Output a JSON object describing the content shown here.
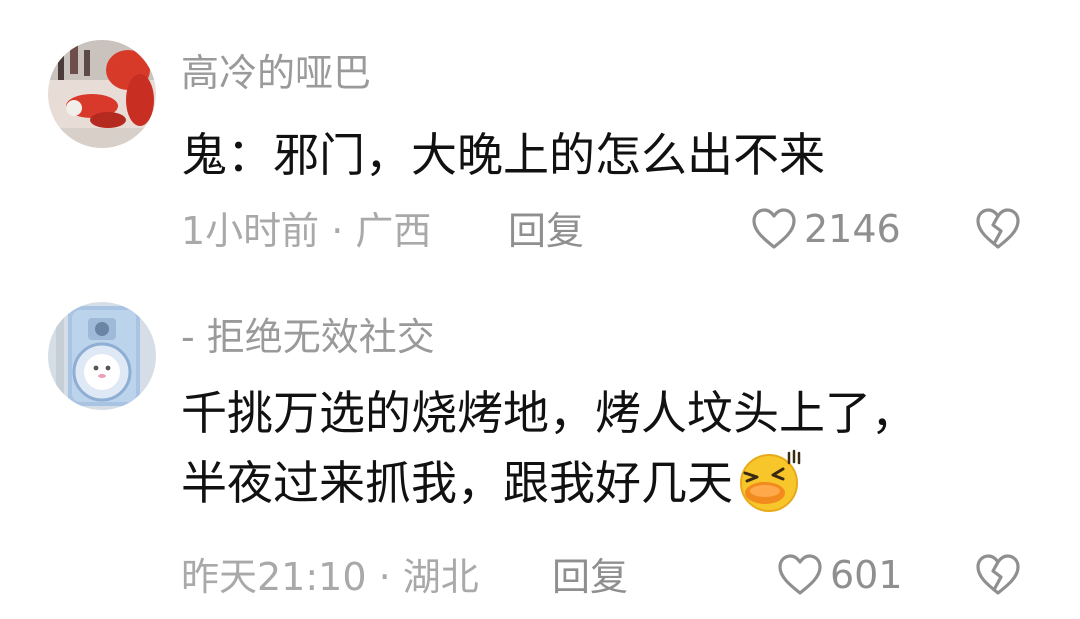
{
  "comments": [
    {
      "username": "高冷的哑巴",
      "text_lines": [
        "鬼：邪门，大晚上的怎么出不来"
      ],
      "time_location": "1小时前 · 广西",
      "reply_label": "回复",
      "like_count": "2146",
      "avatar_icon": "christmas-figures-avatar",
      "like_icon": "heart-outline-icon",
      "dislike_icon": "broken-heart-icon"
    },
    {
      "username": "- 拒绝无效社交",
      "text_lines": [
        "千挑万选的烧烤地，烤人坟头上了，",
        "半夜过来抓我，跟我好几天"
      ],
      "time_location": "昨天21:10 · 湖北",
      "reply_label": "回复",
      "like_count": "601",
      "avatar_icon": "blue-camera-avatar",
      "emoji_icon": "laughing-duck-emoji",
      "like_icon": "heart-outline-icon",
      "dislike_icon": "broken-heart-icon"
    }
  ],
  "colors": {
    "username": "#9a9a9a",
    "body": "#111111",
    "meta": "#a9a9a9",
    "action": "#8f8f8f"
  }
}
